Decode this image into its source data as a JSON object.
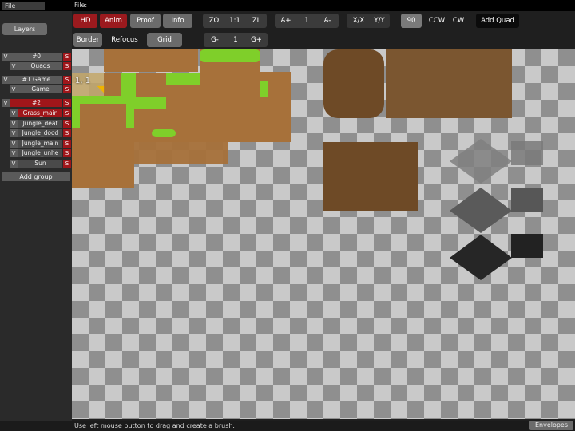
{
  "menu": {
    "file_label": "File",
    "path_label": "File:"
  },
  "toolbar": {
    "hd": "HD",
    "anim": "Anim",
    "proof": "Proof",
    "info": "Info",
    "zo": "ZO",
    "zoom_reset": "1:1",
    "zi": "ZI",
    "a_plus": "A+",
    "a_value": "1",
    "a_minus": "A-",
    "xx": "X/X",
    "yy": "Y/Y",
    "rot_value": "90",
    "ccw": "CCW",
    "cw": "CW",
    "add_quad": "Add Quad",
    "border": "Border",
    "refocus": "Refocus",
    "grid": "Grid",
    "g_minus": "G-",
    "g_value": "1",
    "g_plus": "G+"
  },
  "layers": {
    "header": "Layers",
    "items": [
      {
        "v": "V",
        "name": "#0",
        "s": "S",
        "kind": "group"
      },
      {
        "v": "V",
        "name": "Quads",
        "s": "S",
        "kind": "layer"
      },
      {
        "v": "V",
        "name": "#1 Game",
        "s": "S",
        "kind": "group"
      },
      {
        "v": "V",
        "name": "Game",
        "s": "S",
        "kind": "layer"
      },
      {
        "v": "V",
        "name": "#2",
        "s": "S",
        "kind": "group-selected"
      },
      {
        "v": "V",
        "name": "Grass_main",
        "s": "S",
        "kind": "layer-selected"
      },
      {
        "v": "V",
        "name": "Jungle_deat",
        "s": "S",
        "kind": "layer"
      },
      {
        "v": "V",
        "name": "Jungle_dood",
        "s": "S",
        "kind": "layer"
      },
      {
        "v": "V",
        "name": "Jungle_main",
        "s": "S",
        "kind": "layer"
      },
      {
        "v": "V",
        "name": "Jungle_unhe",
        "s": "S",
        "kind": "layer"
      },
      {
        "v": "V",
        "name": "Sun",
        "s": "S",
        "kind": "layer"
      }
    ],
    "add_group": "Add group"
  },
  "canvas": {
    "coord_label": "1, 1"
  },
  "status": {
    "hint": "Use left mouse button to drag and create a brush.",
    "envelopes": "Envelopes"
  },
  "colors": {
    "accent_red": "#9b1a1e",
    "grass": "#7fcf2a",
    "dirt": "#a7713a",
    "dark_dirt": "#6e4a26"
  }
}
